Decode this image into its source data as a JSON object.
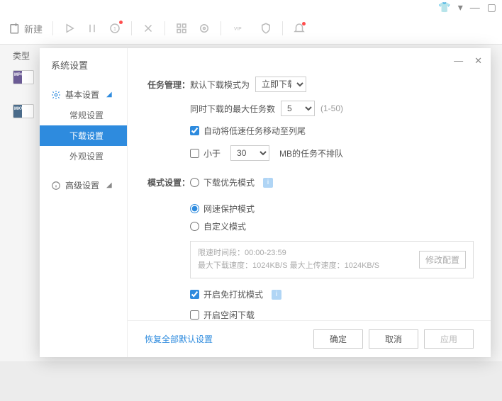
{
  "top": {
    "new_label": "新建"
  },
  "left": {
    "type_label": "类型",
    "thumb1": "MP4",
    "thumb2": "MKV"
  },
  "dialog": {
    "title": "系统设置",
    "groups": {
      "basic": {
        "label": "基本设置",
        "items": [
          "常规设置",
          "下载设置",
          "外观设置"
        ]
      },
      "advanced": {
        "label": "高级设置"
      }
    }
  },
  "task": {
    "section": "任务管理：",
    "default_mode_label": "默认下载模式为",
    "default_mode_value": "立即下载",
    "max_tasks_label": "同时下载的最大任务数",
    "max_tasks_value": "5",
    "max_tasks_hint": "(1-50)",
    "auto_move_label": "自动将低速任务移动至列尾",
    "less_than_label": "小于",
    "less_than_value": "30",
    "less_than_suffix": "MB的任务不排队"
  },
  "mode": {
    "section": "模式设置：",
    "opt1": "下载优先模式",
    "opt2": "网速保护模式",
    "opt3": "自定义模式",
    "limit_line1": "限速时间段：00:00-23:59",
    "limit_line2": "最大下载速度：1024KB/S  最大上传速度：1024KB/S",
    "edit_btn": "修改配置",
    "dnd_label": "开启免打扰模式",
    "idle_label": "开启空闲下载"
  },
  "footer": {
    "restore": "恢复全部默认设置",
    "ok": "确定",
    "cancel": "取消",
    "apply": "应用"
  }
}
